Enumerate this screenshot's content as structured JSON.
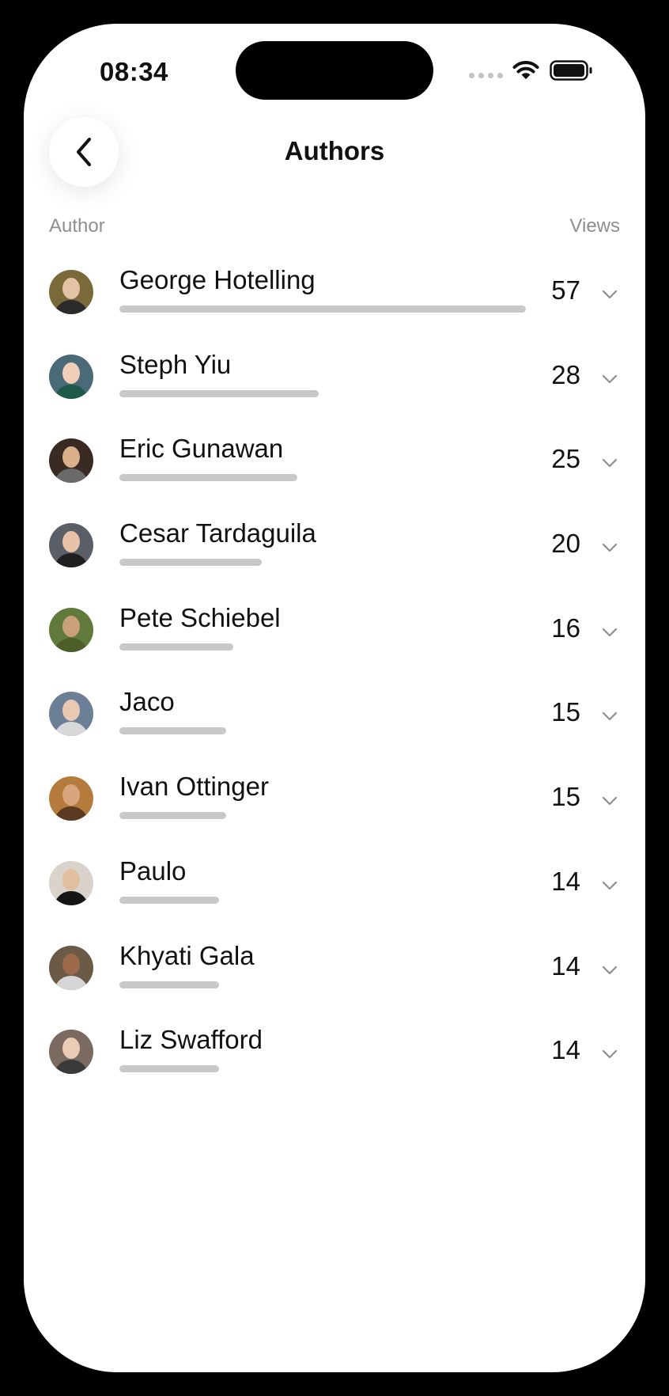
{
  "status_bar": {
    "time": "08:34"
  },
  "header": {
    "title": "Authors",
    "back_icon": "chevron-left-icon"
  },
  "columns": {
    "author": "Author",
    "views": "Views"
  },
  "bar_max": 57,
  "authors": [
    {
      "name": "George Hotelling",
      "views": "57",
      "value": 57,
      "bg": "#7a6a3a",
      "skin": "#e3c3a6",
      "shirt": "#2b2b2b"
    },
    {
      "name": "Steph Yiu",
      "views": "28",
      "value": 28,
      "bg": "#4a6a78",
      "skin": "#f0cfb8",
      "shirt": "#1d5a4a"
    },
    {
      "name": "Eric Gunawan",
      "views": "25",
      "value": 25,
      "bg": "#3a2a24",
      "skin": "#d9b08a",
      "shirt": "#6a6a6a"
    },
    {
      "name": "Cesar Tardaguila",
      "views": "20",
      "value": 20,
      "bg": "#5a5e66",
      "skin": "#e8c2a8",
      "shirt": "#1f1f1f"
    },
    {
      "name": "Pete Schiebel",
      "views": "16",
      "value": 16,
      "bg": "#5f7a3a",
      "skin": "#c9a079",
      "shirt": "#4d5e2a"
    },
    {
      "name": "Jaco",
      "views": "15",
      "value": 15,
      "bg": "#6b7f96",
      "skin": "#eac9b2",
      "shirt": "#d8d8d8"
    },
    {
      "name": "Ivan Ottinger",
      "views": "15",
      "value": 15,
      "bg": "#b57b3c",
      "skin": "#d8a57c",
      "shirt": "#5a3a22"
    },
    {
      "name": "Paulo",
      "views": "14",
      "value": 14,
      "bg": "#d9d3cb",
      "skin": "#e2bf9c",
      "shirt": "#151515"
    },
    {
      "name": "Khyati Gala",
      "views": "14",
      "value": 14,
      "bg": "#6a5a46",
      "skin": "#9c6a4a",
      "shirt": "#d6d6d6"
    },
    {
      "name": "Liz Swafford",
      "views": "14",
      "value": 14,
      "bg": "#7a6a60",
      "skin": "#eacbb6",
      "shirt": "#3a3a3a"
    }
  ]
}
